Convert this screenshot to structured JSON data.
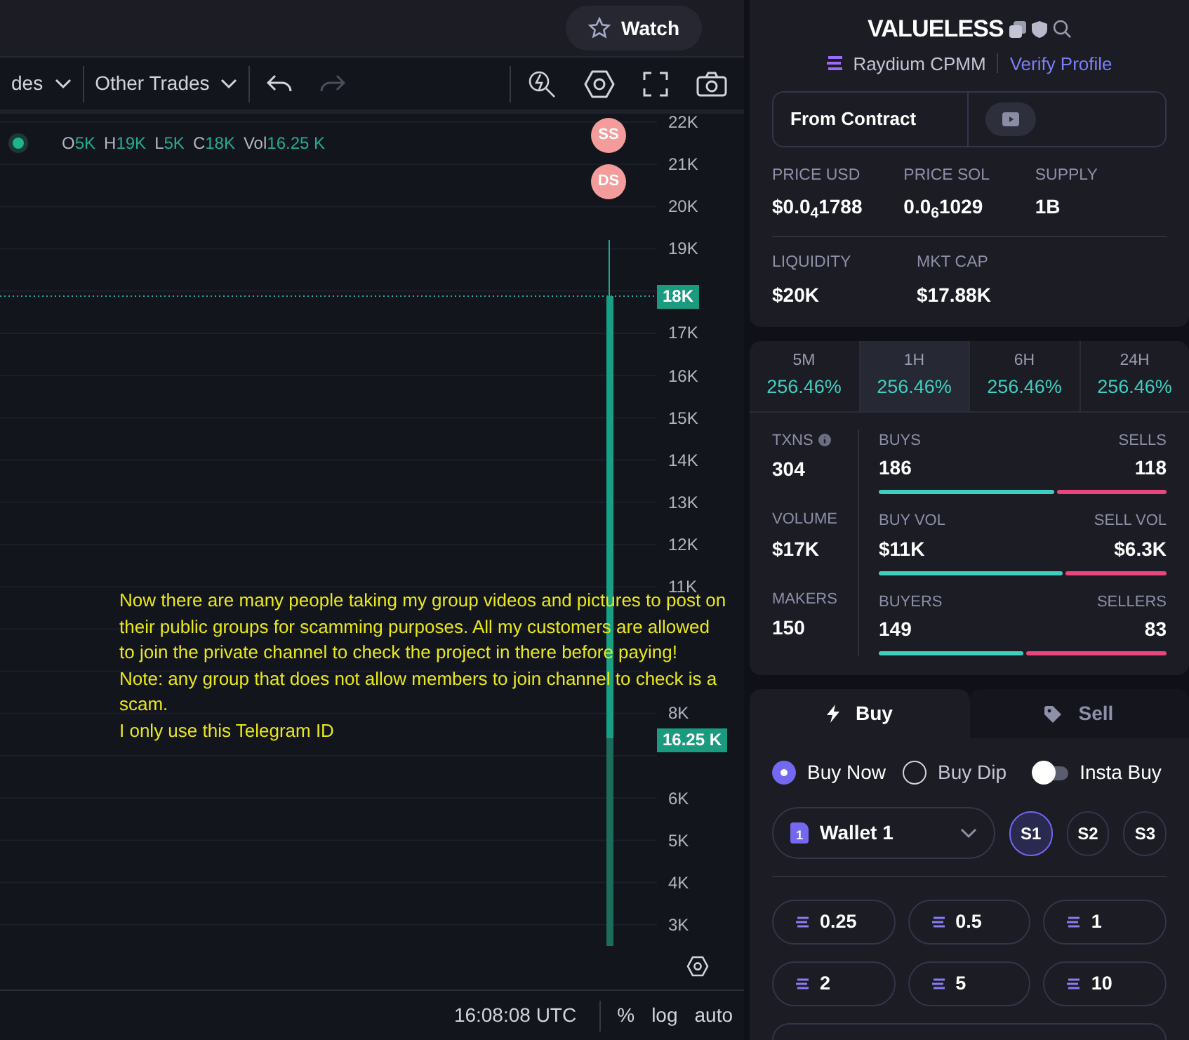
{
  "watch_button": {
    "label": "Watch"
  },
  "toolbar": {
    "dropdowns": [
      {
        "label": "des"
      },
      {
        "label": "Other Trades"
      }
    ]
  },
  "legend": {
    "items": [
      {
        "key": "O",
        "value": "5K"
      },
      {
        "key": "H",
        "value": "19K"
      },
      {
        "key": "L",
        "value": "5K"
      },
      {
        "key": "C",
        "value": "18K"
      },
      {
        "key": "Vol",
        "value": "16.25 K"
      }
    ]
  },
  "markers": [
    {
      "label": "SS"
    },
    {
      "label": "DS"
    }
  ],
  "y_axis": [
    "22K",
    "21K",
    "20K",
    "19K",
    "17K",
    "16K",
    "15K",
    "14K",
    "13K",
    "12K",
    "11K",
    "8K",
    "6K",
    "5K",
    "4K",
    "3K"
  ],
  "price_tags": [
    {
      "label": "18K"
    },
    {
      "label": "16.25 K"
    }
  ],
  "overlay_text": [
    "Now there are many people taking my group videos and pictures to post on",
    "their public groups for scamming purposes. All my customers are allowed",
    "to join the private channel to check the project in there before paying!",
    "Note: any group that does not allow members to join channel to check is a",
    "scam.",
    "I only use this Telegram ID"
  ],
  "bottom_bar": {
    "time": "16:08:08 UTC",
    "options": [
      "%",
      "log",
      "auto"
    ]
  },
  "token": {
    "name": "VALUELESS",
    "dex": "Raydium CPMM",
    "verify": "Verify Profile",
    "contract": "From Contract",
    "stats": [
      {
        "label": "PRICE USD",
        "value": "$0.0$_{4}$1788"
      },
      {
        "label": "PRICE SOL",
        "value": "0.0$_{6}$1029"
      },
      {
        "label": "SUPPLY",
        "value": "1B"
      },
      {
        "label": "LIQUIDITY",
        "value": "$20K"
      },
      {
        "label": "MKT CAP",
        "value": "$17.88K"
      }
    ]
  },
  "periods": [
    {
      "label": "5M",
      "change": "256.46%",
      "selected": false
    },
    {
      "label": "1H",
      "change": "256.46%",
      "selected": true
    },
    {
      "label": "6H",
      "change": "256.46%",
      "selected": false
    },
    {
      "label": "24H",
      "change": "256.46%",
      "selected": false
    }
  ],
  "metrics": [
    {
      "label": "TXNS",
      "value": "304",
      "info": true,
      "left_label": "BUYS",
      "left_value": "186",
      "right_label": "SELLS",
      "right_value": "118",
      "level": 0.61
    },
    {
      "label": "VOLUME",
      "value": "$17K",
      "info": false,
      "left_label": "BUY VOL",
      "left_value": "$11K",
      "right_label": "SELL VOL",
      "right_value": "$6.3K",
      "level": 0.64
    },
    {
      "label": "MAKERS",
      "value": "150",
      "info": false,
      "left_label": "BUYERS",
      "left_value": "149",
      "right_label": "SELLERS",
      "right_value": "83",
      "level": 0.5
    }
  ],
  "trade_tabs": [
    {
      "label": "Buy",
      "kind": "buy",
      "selected": true
    },
    {
      "label": "Sell",
      "kind": "sell",
      "selected": false
    }
  ],
  "order_types": [
    {
      "label": "Buy Now",
      "kind": "radio",
      "selected": true
    },
    {
      "label": "Buy Dip",
      "kind": "radio",
      "selected": false
    },
    {
      "label": "Insta Buy",
      "kind": "toggle",
      "on": false
    }
  ],
  "wallet": {
    "badge": "1",
    "label": "Wallet 1"
  },
  "slots": [
    {
      "label": "S1",
      "selected": true
    },
    {
      "label": "S2",
      "selected": false
    },
    {
      "label": "S3",
      "selected": false
    }
  ],
  "amounts": [
    "0.25",
    "0.5",
    "1",
    "2",
    "5",
    "10"
  ]
}
